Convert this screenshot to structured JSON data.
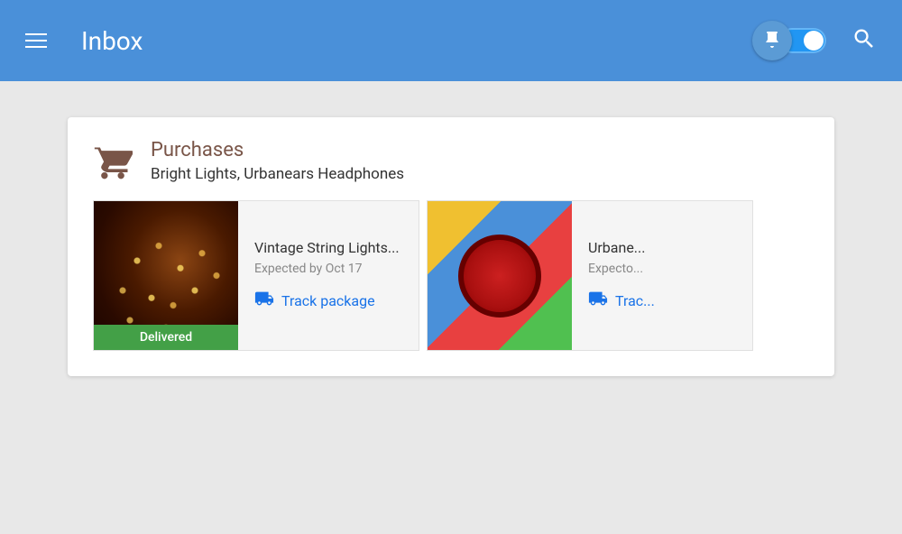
{
  "header": {
    "title": "Inbox",
    "menu_icon": "menu-icon",
    "toggle_label": "toggle",
    "search_icon": "search-icon"
  },
  "card": {
    "category": "Purchases",
    "subtitle": "Bright Lights, Urbanears Headphones",
    "cart_icon": "cart-icon",
    "items": [
      {
        "name": "Vintage String Lights...",
        "expected": "Expected by Oct 17",
        "track_label": "Track package",
        "status": "Delivered",
        "image_type": "string-lights"
      },
      {
        "name": "Urbane...",
        "expected": "Expecto...",
        "track_label": "Trac...",
        "image_type": "headphones"
      }
    ]
  }
}
